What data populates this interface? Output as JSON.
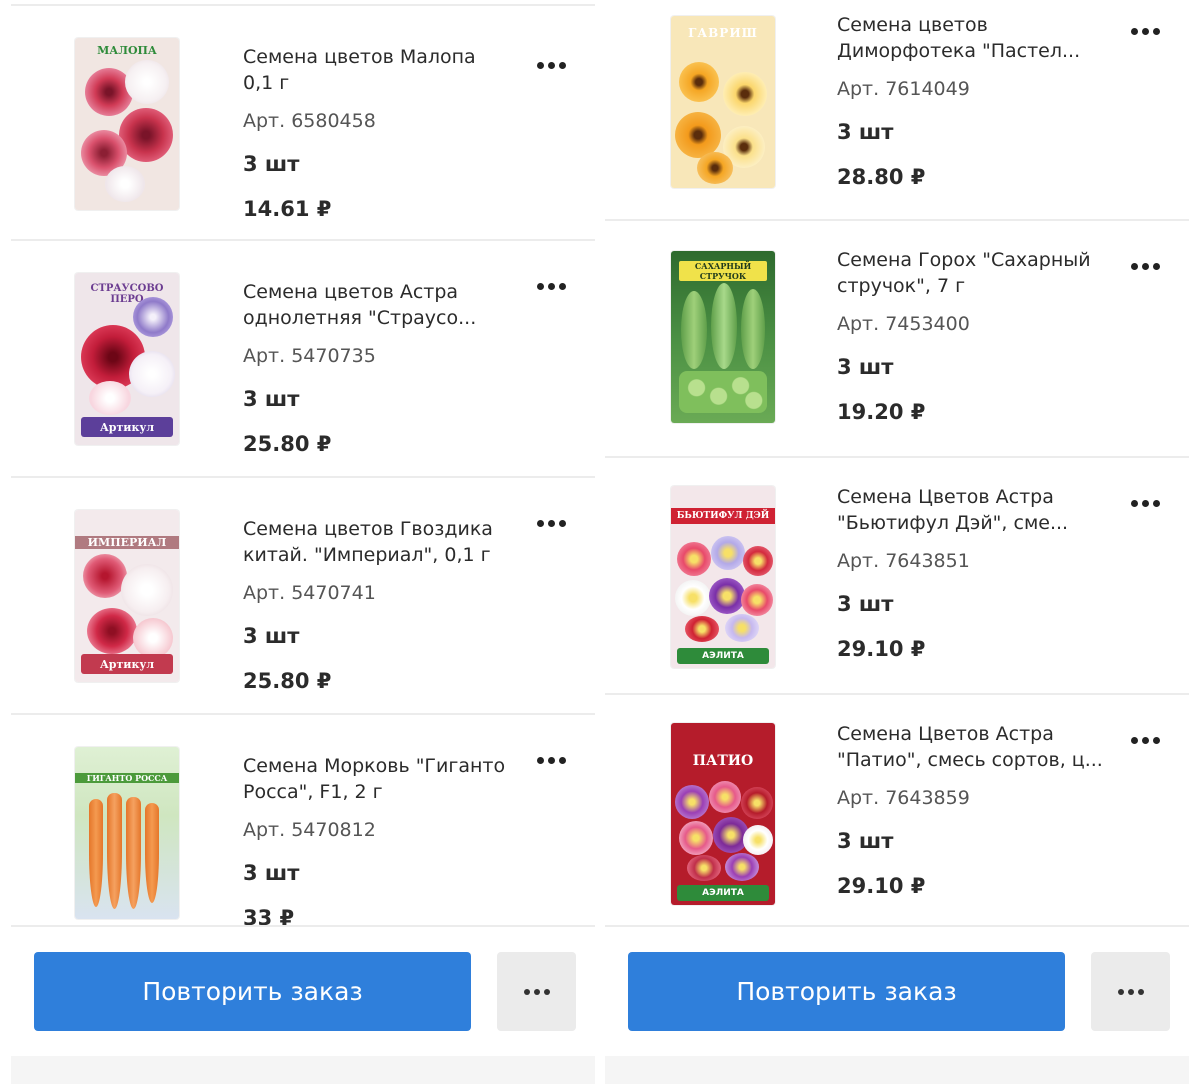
{
  "orders": [
    {
      "items": [
        {
          "title": "Семена цветов Малопа 0,1 г",
          "sku": "Арт. 6580458",
          "qty": "3 шт",
          "price": "14.61 ₽",
          "image": "seed-packet-malope"
        },
        {
          "title": "Семена цветов Астра однолетняя \"Страусо...",
          "sku": "Арт. 5470735",
          "qty": "3 шт",
          "price": "25.80 ₽",
          "image": "seed-packet-aster"
        },
        {
          "title": "Семена цветов Гвоздика китай. \"Империал\", 0,1 г",
          "sku": "Арт. 5470741",
          "qty": "3 шт",
          "price": "25.80 ₽",
          "image": "seed-packet-carnation"
        },
        {
          "title": "Семена Морковь \"Гиганто Росса\", F1,  2 г",
          "sku": "Арт. 5470812",
          "qty": "3 шт",
          "price": "33 ₽",
          "image": "seed-packet-carrot"
        }
      ],
      "repeat_label": "Повторить заказ"
    },
    {
      "items": [
        {
          "title": "Семена цветов Диморфотека \"Пастел...",
          "sku": "Арт. 7614049",
          "qty": "3 шт",
          "price": "28.80 ₽",
          "image": "seed-packet-dimorphotheca"
        },
        {
          "title": "Семена Горох \"Сахарный стручок\", 7 г",
          "sku": "Арт. 7453400",
          "qty": "3 шт",
          "price": "19.20 ₽",
          "image": "seed-packet-pea"
        },
        {
          "title": "Семена Цветов Астра \"Бьютифул Дэй\", сме...",
          "sku": "Арт. 7643851",
          "qty": "3 шт",
          "price": "29.10 ₽",
          "image": "seed-packet-aster-beautiful-day"
        },
        {
          "title": "Семена Цветов Астра \"Патио\", смесь сортов, ц...",
          "sku": "Арт. 7643859",
          "qty": "3 шт",
          "price": "29.10 ₽",
          "image": "seed-packet-aster-patio"
        }
      ],
      "repeat_label": "Повторить заказ"
    }
  ],
  "packets": {
    "malope": {
      "label": "МАЛОПА",
      "brand": "",
      "colors": [
        "#f3e9e4",
        "#c8334d",
        "#e86b86"
      ]
    },
    "aster": {
      "label": "СТРАУСОВО ПЕРО",
      "brand": "Артикул",
      "colors": [
        "#f1e8ea",
        "#c21d3a",
        "#8f7ac9"
      ]
    },
    "carnation": {
      "label": "ИМПЕРИАЛ",
      "brand": "Артикул",
      "colors": [
        "#f4ecee",
        "#d02947",
        "#f6c8d0"
      ]
    },
    "carrot": {
      "label": "ГИГАНТО РОССА",
      "brand": "",
      "colors": [
        "#dff0d4",
        "#ef8a38",
        "#4c9a3b"
      ]
    },
    "dimorphotheca": {
      "label": "ГАВРИШ",
      "brand": "",
      "colors": [
        "#f8e2a8",
        "#f5a623",
        "#fbd66b"
      ]
    },
    "pea": {
      "label": "САХАРНЫЙ СТРУЧОК",
      "brand": "",
      "colors": [
        "#3b7f3a",
        "#7fbf5c",
        "#a8d98a"
      ]
    },
    "aster_beautiful_day": {
      "label": "БЬЮТИФУЛ ДЭЙ",
      "brand": "АЭЛИТА",
      "colors": [
        "#cf2233",
        "#b3a9e8",
        "#e84a6a"
      ]
    },
    "aster_patio": {
      "label": "ПАТИО",
      "brand": "АЭЛИТА",
      "colors": [
        "#b51c2b",
        "#9b3fb5",
        "#e65a8a"
      ]
    }
  },
  "colors": {
    "accent": "#2f7fdb",
    "secondary_button": "#ebebeb",
    "divider": "#ececec",
    "text": "#2b2b2b"
  }
}
